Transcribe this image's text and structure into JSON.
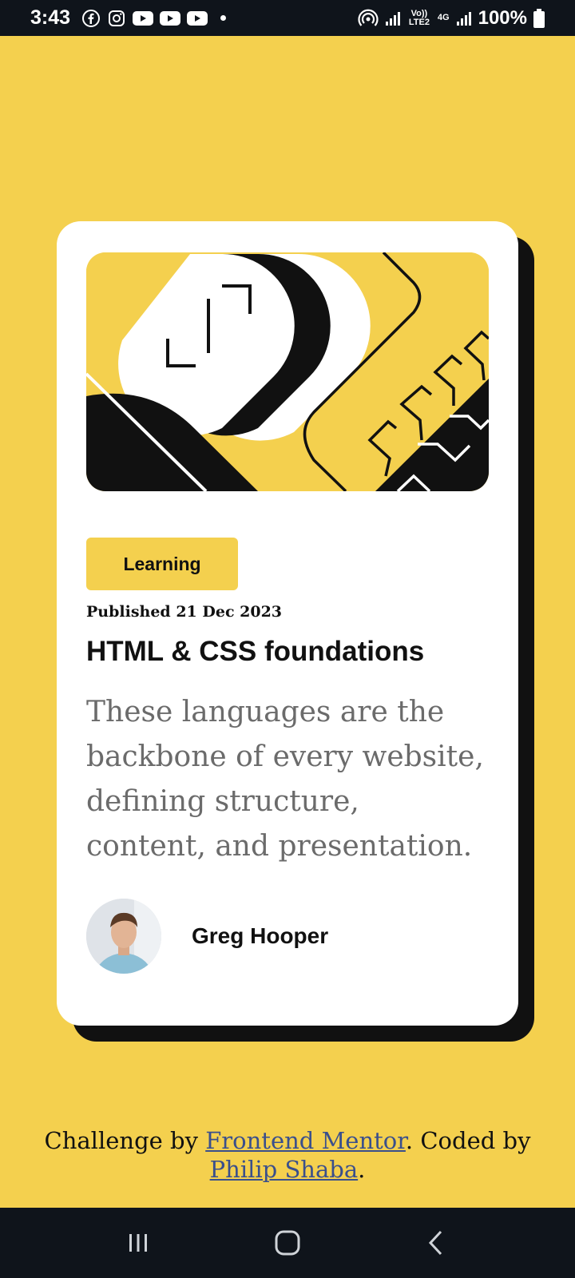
{
  "status_bar": {
    "time": "3:43",
    "battery_percent": "100%",
    "network": "Vo)) LTE2",
    "network_type": "4G",
    "notification_icons": [
      "facebook-icon",
      "instagram-icon",
      "youtube-icon",
      "youtube-icon",
      "youtube-icon"
    ]
  },
  "card": {
    "tag": "Learning",
    "published": "Published 21 Dec 2023",
    "title": "HTML & CSS foundations",
    "description": "These languages are the backbone of every website, defining structure, content, and presentation.",
    "author": {
      "name": "Greg Hooper"
    }
  },
  "footer": {
    "prefix": "Challenge by ",
    "link1": "Frontend Mentor",
    "middle": ". Coded by ",
    "link2": "Philip Shaba",
    "suffix": "."
  },
  "colors": {
    "background": "#f4d04e",
    "card": "#ffffff",
    "shadow": "#111111",
    "system_bar": "#0f141b"
  },
  "nav_bar": {
    "buttons": [
      "recent-apps-icon",
      "home-icon",
      "back-icon"
    ]
  }
}
